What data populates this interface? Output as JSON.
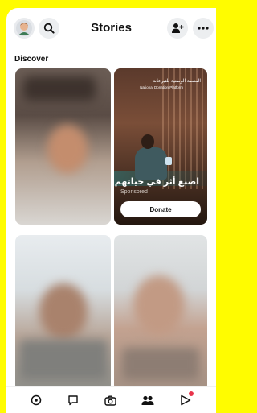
{
  "header": {
    "title": "Stories"
  },
  "discover": {
    "label": "Discover",
    "ad": {
      "brand_ar": "المنصة الوطنية للتبرعات",
      "brand_en": "National Donation Platform",
      "headline": "اصنع أثر في حياتهم",
      "sponsored": "Sponsored",
      "cta": "Donate"
    }
  },
  "colors": {
    "brand": "#FFFC00",
    "notify": "#e8344b"
  },
  "nav": {
    "items": [
      "map-icon",
      "chat-icon",
      "camera-icon",
      "stories-icon",
      "spotlight-icon"
    ]
  }
}
